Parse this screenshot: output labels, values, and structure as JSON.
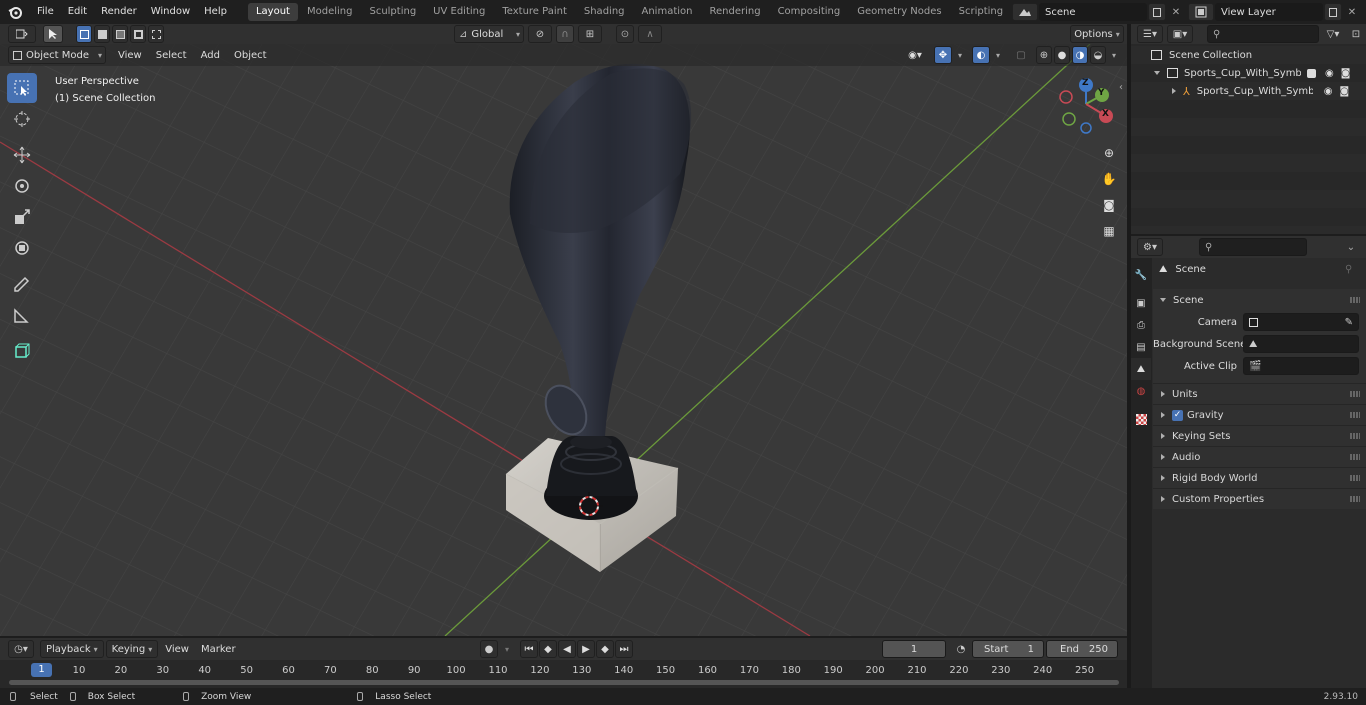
{
  "menus": [
    "File",
    "Edit",
    "Render",
    "Window",
    "Help"
  ],
  "workspace_tabs": [
    {
      "label": "Layout",
      "active": true
    },
    {
      "label": "Modeling"
    },
    {
      "label": "Sculpting"
    },
    {
      "label": "UV Editing"
    },
    {
      "label": "Texture Paint"
    },
    {
      "label": "Shading"
    },
    {
      "label": "Animation"
    },
    {
      "label": "Rendering"
    },
    {
      "label": "Compositing"
    },
    {
      "label": "Geometry Nodes"
    },
    {
      "label": "Scripting"
    }
  ],
  "add_workspace": "+",
  "scene_name": "Scene",
  "view_layer": "View Layer",
  "viewport_header": {
    "mode": "Object Mode",
    "menus": [
      "View",
      "Select",
      "Add",
      "Object"
    ],
    "orientation": "Global",
    "options": "Options"
  },
  "overlay_text": {
    "perspective": "User Perspective",
    "collection": "(1) Scene Collection"
  },
  "gizmo_axes": {
    "x": "X",
    "y": "Y",
    "z": "Z"
  },
  "colors": {
    "accent": "#4772b3",
    "x_axis": "#c84a55",
    "y_axis": "#6fa544",
    "z_axis": "#3f79c8"
  },
  "outliner": {
    "root": "Scene Collection",
    "items": [
      {
        "label": "Sports_Cup_With_Symbol_Bro",
        "level": 1
      },
      {
        "label": "Sports_Cup_With_Symbo",
        "level": 2
      }
    ]
  },
  "properties": {
    "title": "Scene",
    "section": "Scene",
    "fields": [
      {
        "label": "Camera",
        "icon": "camera-data-icon"
      },
      {
        "label": "Background Scene",
        "icon": "scene-data-icon"
      },
      {
        "label": "Active Clip",
        "icon": "clip-icon"
      }
    ],
    "subpanels": [
      {
        "label": "Units"
      },
      {
        "label": "Gravity",
        "checkbox": true,
        "checked": true
      },
      {
        "label": "Keying Sets"
      },
      {
        "label": "Audio"
      },
      {
        "label": "Rigid Body World"
      },
      {
        "label": "Custom Properties"
      }
    ]
  },
  "timeline": {
    "menus": [
      "Playback",
      "Keying",
      "View",
      "Marker"
    ],
    "current_frame": "1",
    "start_label": "Start",
    "start": "1",
    "end_label": "End",
    "end": "250",
    "ruler": [
      "10",
      "20",
      "30",
      "40",
      "50",
      "60",
      "70",
      "80",
      "90",
      "100",
      "110",
      "120",
      "130",
      "140",
      "150",
      "160",
      "170",
      "180",
      "190",
      "200",
      "210",
      "220",
      "230",
      "240",
      "250"
    ],
    "playhead": "1"
  },
  "statusbar": {
    "select": "Select",
    "box_select": "Box Select",
    "zoom_view": "Zoom View",
    "lasso_select": "Lasso Select",
    "version": "2.93.10"
  }
}
